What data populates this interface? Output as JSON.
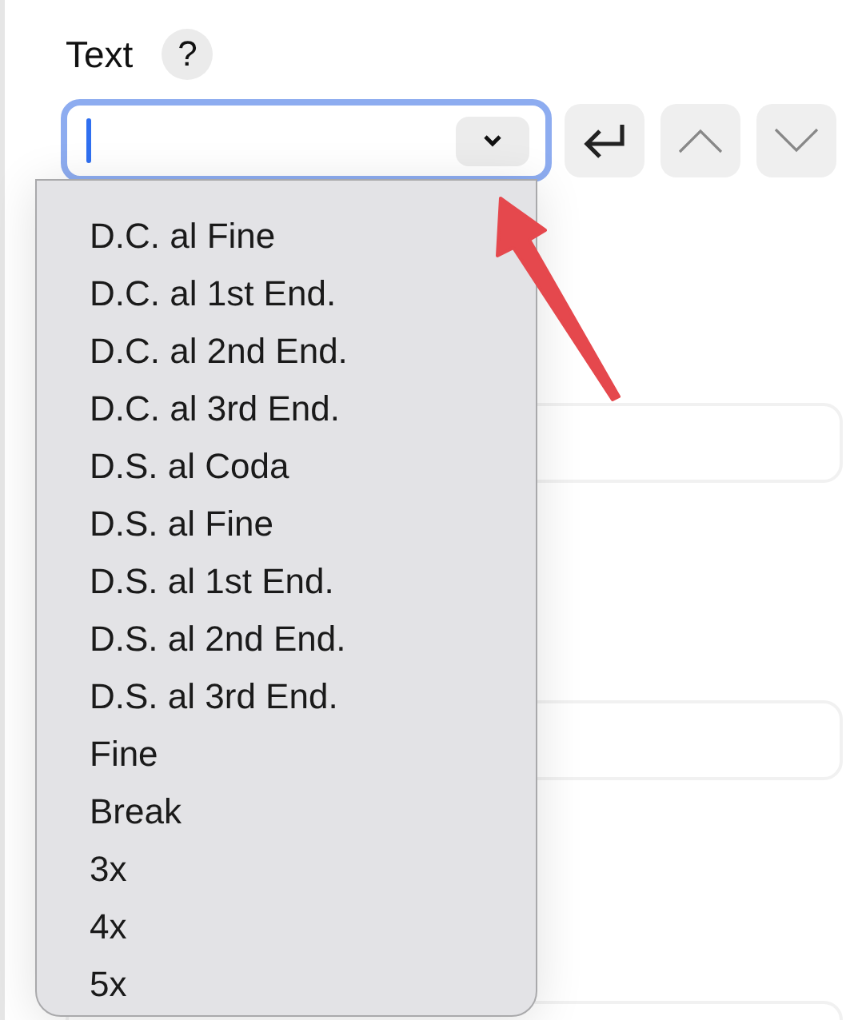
{
  "label": "Text",
  "help": "?",
  "combo": {
    "focused": true
  },
  "buttons": [
    {
      "kind": "enter"
    },
    {
      "kind": "up"
    },
    {
      "kind": "down"
    }
  ],
  "menu": {
    "items": [
      "D.C. al Fine",
      "D.C. al 1st End.",
      "D.C. al 2nd End.",
      "D.C. al 3rd End.",
      "D.S. al Coda",
      "D.S. al Fine",
      "D.S. al 1st End.",
      "D.S. al 2nd End.",
      "D.S. al 3rd End.",
      "Fine",
      "Break",
      "3x",
      "4x",
      "5x"
    ]
  }
}
